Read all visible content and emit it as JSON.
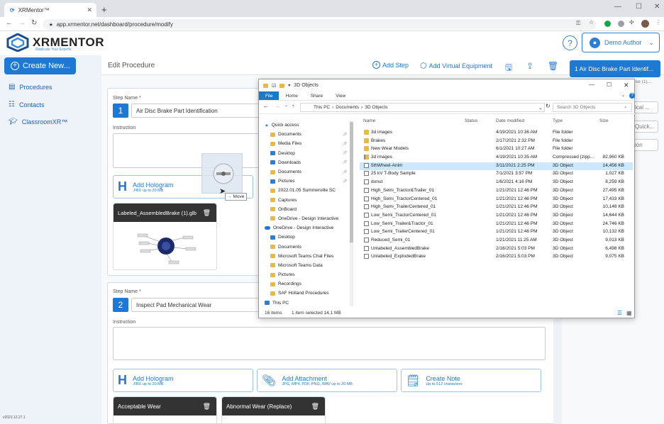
{
  "browser": {
    "tab_title": "XRMentor™",
    "url": "app.xrmentor.net/dashboard/procedure/modify"
  },
  "header": {
    "logo_text": "MENTOR",
    "logo_prefix": "XR",
    "tagline": "Replicate Your Experts",
    "help_label": "?",
    "author_label": "Demo Author"
  },
  "sidebar": {
    "create_label": "Create New...",
    "items": [
      {
        "label": "Procedures",
        "icon": "procedures-icon"
      },
      {
        "label": "Contacts",
        "icon": "contacts-icon"
      },
      {
        "label": "ClassroomXR™",
        "icon": "classroom-icon"
      }
    ],
    "version": "v2021.12.27.1"
  },
  "toolbar": {
    "title": "Edit Procedure",
    "add_step": "Add Step",
    "add_equipment": "Add Virtual Equipment"
  },
  "steps": [
    {
      "label": "Step Name *",
      "number": "1",
      "name": "Air Disc Brake Part Identification",
      "instruction_label": "Instruction",
      "hologram_title": "Add Hologram",
      "hologram_sub": ".FBX up to 20 MB",
      "thumb_title": "Labeled_AssembledBrake (1).glb"
    },
    {
      "label": "Step Name *",
      "number": "2",
      "name": "Inspect Pad Mechanical Wear",
      "instruction_label": "Instruction",
      "hologram_title": "Add Hologram",
      "hologram_sub": ".FBX up to 20 MB",
      "attachment_title": "Add Attachment",
      "attachment_sub": "JPG, MP4, PDF, PNG, WAV up to 20 MB",
      "note_title": "Create Note",
      "note_sub": "Up to 512 characters",
      "thumb1_title": "Acceptable Wear",
      "thumb2_title": "Abnormal Wear (Replace)"
    }
  ],
  "right_panel": {
    "active_step": "1  Air Disc Brake Part Identif...",
    "ghost1": "ical ...",
    "ghost2": "Quick...",
    "ghost3": "ion",
    "ghost_sub": "ke (1)..."
  },
  "explorer": {
    "title": "3D Objects",
    "ribbon": [
      "File",
      "Home",
      "Share",
      "View"
    ],
    "path": [
      "This PC",
      "Documents",
      "3D Objects"
    ],
    "search_placeholder": "Search 3D Objects",
    "nav": [
      {
        "label": "Quick access",
        "kind": "star",
        "indent": 0
      },
      {
        "label": "Documents",
        "kind": "folder",
        "indent": 1
      },
      {
        "label": "Media Files",
        "kind": "folder",
        "indent": 1
      },
      {
        "label": "Desktop",
        "kind": "blue",
        "indent": 1
      },
      {
        "label": "Downloads",
        "kind": "blue",
        "indent": 1
      },
      {
        "label": "Documents",
        "kind": "folder",
        "indent": 1
      },
      {
        "label": "Pictures",
        "kind": "blue",
        "indent": 1
      },
      {
        "label": "2022.01.05 Summerville SC",
        "kind": "folder",
        "indent": 1
      },
      {
        "label": "Captures",
        "kind": "folder",
        "indent": 1
      },
      {
        "label": "OnBoard",
        "kind": "folder",
        "indent": 1
      },
      {
        "label": "OneDrive - Design Interactive",
        "kind": "folder",
        "indent": 1
      },
      {
        "label": "OneDrive - Design Interactive",
        "kind": "cloud",
        "indent": 0
      },
      {
        "label": "Desktop",
        "kind": "blue",
        "indent": 1
      },
      {
        "label": "Documents",
        "kind": "folder",
        "indent": 1
      },
      {
        "label": "Microsoft Teams Chat Files",
        "kind": "folder",
        "indent": 1
      },
      {
        "label": "Microsoft Teams Data",
        "kind": "folder",
        "indent": 1
      },
      {
        "label": "Pictures",
        "kind": "folder",
        "indent": 1
      },
      {
        "label": "Recordings",
        "kind": "folder",
        "indent": 1
      },
      {
        "label": "SAF Holland Procedures",
        "kind": "folder",
        "indent": 1
      },
      {
        "label": "This PC",
        "kind": "blue",
        "indent": 0
      }
    ],
    "columns": {
      "name": "Name",
      "status": "Status",
      "date": "Date modified",
      "type": "Type",
      "size": "Size"
    },
    "files": [
      {
        "name": "3d images",
        "date": "4/19/2021 10:36 AM",
        "type": "File folder",
        "size": "",
        "kind": "folder"
      },
      {
        "name": "Brakes",
        "date": "2/17/2021 2:32 PM",
        "type": "File folder",
        "size": "",
        "kind": "folder"
      },
      {
        "name": "New Wear Models",
        "date": "6/1/2021 10:27 AM",
        "type": "File folder",
        "size": "",
        "kind": "folder"
      },
      {
        "name": "3d images",
        "date": "4/19/2021 10:35 AM",
        "type": "Compressed (zipp...",
        "size": "82,960 KB",
        "kind": "zip"
      },
      {
        "name": "5thWheel-Anim",
        "date": "3/11/2021 2:25 PM",
        "type": "3D Object",
        "size": "14,456 KB",
        "kind": "obj",
        "selected": true
      },
      {
        "name": "25 kV T-Body Sample",
        "date": "7/1/2021 3:57 PM",
        "type": "3D Object",
        "size": "1,027 KB",
        "kind": "obj"
      },
      {
        "name": "donut",
        "date": "1/6/2021 4:16 PM",
        "type": "3D Object",
        "size": "8,259 KB",
        "kind": "obj"
      },
      {
        "name": "High_Semi_Tractor&Trailer_01",
        "date": "1/21/2021 12:46 PM",
        "type": "3D Object",
        "size": "27,495 KB",
        "kind": "obj"
      },
      {
        "name": "High_Semi_TractorCentered_01",
        "date": "1/21/2021 12:46 PM",
        "type": "3D Object",
        "size": "17,433 KB",
        "kind": "obj"
      },
      {
        "name": "High_Semi_TrailerCentered_01",
        "date": "1/21/2021 12:46 PM",
        "type": "3D Object",
        "size": "10,148 KB",
        "kind": "obj"
      },
      {
        "name": "Low_Semi_TractorCentered_01",
        "date": "1/21/2021 12:46 PM",
        "type": "3D Object",
        "size": "14,644 KB",
        "kind": "obj"
      },
      {
        "name": "Low_Semi_Trailer&Tractor_01",
        "date": "1/21/2021 12:46 PM",
        "type": "3D Object",
        "size": "24,746 KB",
        "kind": "obj"
      },
      {
        "name": "Low_Semi_TrailerCentered_01",
        "date": "1/21/2021 12:46 PM",
        "type": "3D Object",
        "size": "10,132 KB",
        "kind": "obj"
      },
      {
        "name": "Reduced_Semi_01",
        "date": "1/21/2021 11:25 AM",
        "type": "3D Object",
        "size": "9,013 KB",
        "kind": "obj"
      },
      {
        "name": "Unlabeled_AssembledBrake",
        "date": "2/16/2021 5:03 PM",
        "type": "3D Object",
        "size": "6,498 KB",
        "kind": "obj"
      },
      {
        "name": "Unlabeled_ExplodedBrake",
        "date": "2/16/2021 5:03 PM",
        "type": "3D Object",
        "size": "9,075 KB",
        "kind": "obj"
      }
    ],
    "status_count": "16 items",
    "status_selected": "1 item selected  14.1 MB"
  },
  "drag": {
    "badge": "Move"
  },
  "colors": {
    "accent": "#1f78d1",
    "selected_row": "#cce8ff"
  }
}
